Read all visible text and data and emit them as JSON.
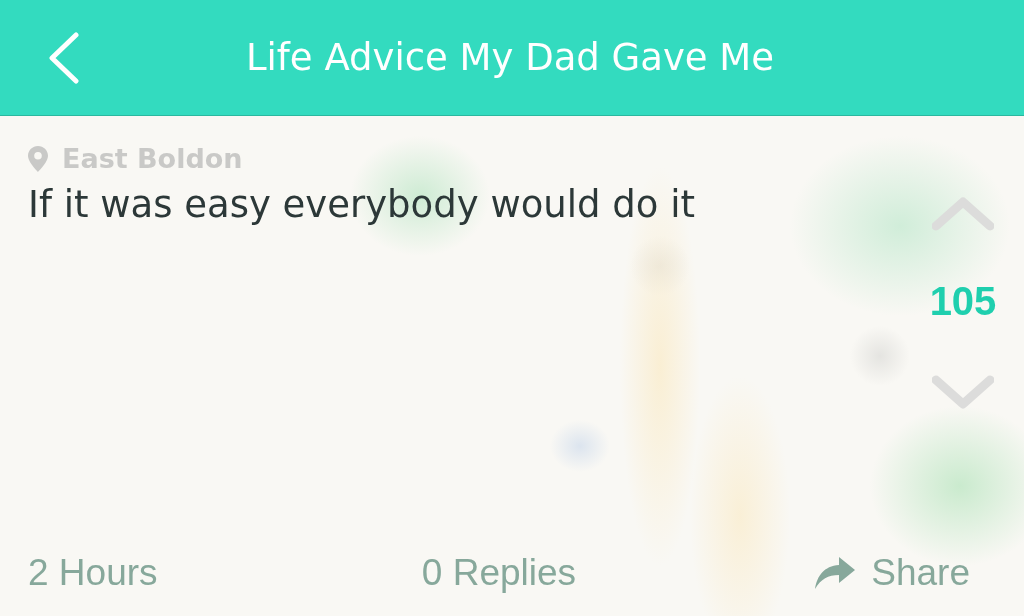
{
  "nav_bar": {
    "title": "Life Advice My Dad Gave Me"
  },
  "post": {
    "location": "East Boldon",
    "message": "If it was easy everybody would do it",
    "vote": {
      "upvoted": false,
      "score": "105",
      "downvoted": false
    },
    "footer": {
      "age": "2 Hours",
      "replies": "0 Replies",
      "share": "Share"
    }
  }
}
